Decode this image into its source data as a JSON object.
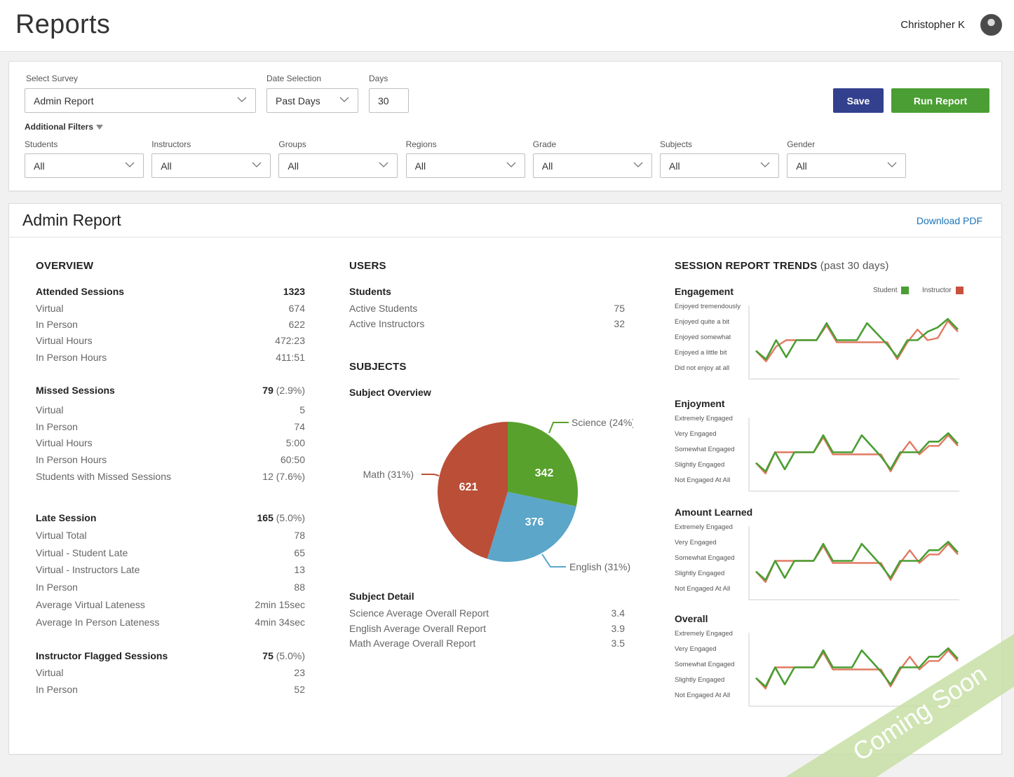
{
  "header": {
    "title": "Reports",
    "user_name": "Christopher K"
  },
  "filters": {
    "survey": {
      "label": "Select Survey",
      "value": "Admin Report"
    },
    "date_selection": {
      "label": "Date Selection",
      "value": "Past Days"
    },
    "days": {
      "label": "Days",
      "value": "30"
    },
    "save_label": "Save",
    "run_label": "Run Report",
    "additional_label": "Additional Filters",
    "dropdowns": [
      {
        "label": "Students",
        "value": "All"
      },
      {
        "label": "Instructors",
        "value": "All"
      },
      {
        "label": "Groups",
        "value": "All"
      },
      {
        "label": "Regions",
        "value": "All"
      },
      {
        "label": "Grade",
        "value": "All"
      },
      {
        "label": "Subjects",
        "value": "All"
      },
      {
        "label": "Gender",
        "value": "All"
      }
    ]
  },
  "report": {
    "title": "Admin Report",
    "download_label": "Download PDF",
    "overview": {
      "heading": "OVERVIEW",
      "attended": {
        "label": "Attended Sessions",
        "value": "1323"
      },
      "attended_rows": [
        {
          "k": "Virtual",
          "v": "674"
        },
        {
          "k": "In Person",
          "v": "622"
        },
        {
          "k": "Virtual Hours",
          "v": "472:23"
        },
        {
          "k": "In Person Hours",
          "v": "411:51"
        }
      ],
      "missed": {
        "label": "Missed Sessions",
        "value": "79",
        "pct": "(2.9%)"
      },
      "missed_rows": [
        {
          "k": "Virtual",
          "v": "5"
        },
        {
          "k": "In Person",
          "v": "74"
        },
        {
          "k": "Virtual Hours",
          "v": "5:00"
        },
        {
          "k": "In Person Hours",
          "v": "60:50"
        },
        {
          "k": "Students with Missed Sessions",
          "v": "12",
          "pct": "(7.6%)"
        }
      ],
      "late": {
        "label": "Late Session",
        "value": "165",
        "pct": "(5.0%)"
      },
      "late_rows": [
        {
          "k": "Virtual Total",
          "v": "78"
        },
        {
          "k": "Virtual - Student Late",
          "v": "65"
        },
        {
          "k": "Virtual - Instructors Late",
          "v": "13"
        },
        {
          "k": "In Person",
          "v": "88"
        },
        {
          "k": "Average Virtual Lateness",
          "v": "2min 15sec"
        },
        {
          "k": "Average In Person Lateness",
          "v": "4min 34sec"
        }
      ],
      "flagged": {
        "label": "Instructor Flagged Sessions",
        "value": "75",
        "pct": "(5.0%)"
      },
      "flagged_rows": [
        {
          "k": "Virtual",
          "v": "23"
        },
        {
          "k": "In Person",
          "v": "52"
        }
      ]
    },
    "users": {
      "heading": "USERS",
      "students_label": "Students",
      "rows": [
        {
          "k": "Active Students",
          "v": "75"
        },
        {
          "k": "Active Instructors",
          "v": "32"
        }
      ]
    },
    "subjects": {
      "heading": "SUBJECTS",
      "overview_label": "Subject Overview",
      "detail_label": "Subject Detail",
      "detail_rows": [
        {
          "k": "Science Average Overall Report",
          "v": "3.4"
        },
        {
          "k": "English Average Overall Report",
          "v": "3.9"
        },
        {
          "k": "Math Average Overall Report",
          "v": "3.5"
        }
      ]
    },
    "trends": {
      "heading": "SESSION REPORT TRENDS",
      "heading_suffix": "(past 30 days)",
      "legend_student": "Student",
      "legend_instructor": "Instructor",
      "colors": {
        "student": "#4a9e33",
        "instructor": "#e07a62"
      }
    }
  },
  "watermark": "Coming Soon",
  "chart_data": [
    {
      "type": "pie",
      "title": "Subject Overview",
      "slices": [
        {
          "label": "Science",
          "value": 342,
          "pct_label": "(24%)",
          "color": "#58a12c"
        },
        {
          "label": "English",
          "value": 376,
          "pct_label": "(31%)",
          "color": "#5ba6c9"
        },
        {
          "label": "Math",
          "value": 621,
          "pct_label": "(31%)",
          "color": "#bb4e37"
        }
      ]
    },
    {
      "type": "line",
      "title": "Engagement",
      "y_levels": [
        "Enjoyed tremendously",
        "Enjoyed quite a bit",
        "Enjoyed somewhat",
        "Enjoyed a little bit",
        "Did not enjoy at all"
      ],
      "series": [
        {
          "name": "Student",
          "values": [
            2.0,
            1.6,
            2.5,
            1.7,
            2.5,
            2.5,
            2.5,
            3.3,
            2.5,
            2.5,
            2.5,
            3.3,
            2.8,
            2.3,
            1.7,
            2.5,
            2.5,
            2.9,
            3.1,
            3.5,
            3.0
          ]
        },
        {
          "name": "Instructor",
          "values": [
            2.0,
            1.5,
            2.2,
            2.5,
            2.5,
            2.5,
            2.5,
            3.2,
            2.4,
            2.4,
            2.4,
            2.4,
            2.4,
            2.4,
            1.6,
            2.4,
            3.0,
            2.5,
            2.6,
            3.4,
            2.9
          ]
        }
      ]
    },
    {
      "type": "line",
      "title": "Enjoyment",
      "y_levels": [
        "Extremely Engaged",
        "Very Engaged",
        "Somewhat Engaged",
        "Slightly Engaged",
        "Not Engaged At All"
      ],
      "series": [
        {
          "name": "Student",
          "values": [
            2.0,
            1.6,
            2.5,
            1.7,
            2.5,
            2.5,
            2.5,
            3.3,
            2.5,
            2.5,
            2.5,
            3.3,
            2.8,
            2.3,
            1.7,
            2.5,
            2.5,
            2.5,
            3.0,
            3.0,
            3.4,
            2.9
          ]
        },
        {
          "name": "Instructor",
          "values": [
            2.0,
            1.5,
            2.5,
            2.5,
            2.5,
            2.5,
            2.5,
            3.2,
            2.4,
            2.4,
            2.4,
            2.4,
            2.4,
            2.4,
            1.6,
            2.4,
            3.0,
            2.4,
            2.8,
            2.8,
            3.3,
            2.8
          ]
        }
      ]
    },
    {
      "type": "line",
      "title": "Amount Learned",
      "y_levels": [
        "Extremely Engaged",
        "Very Engaged",
        "Somewhat Engaged",
        "Slightly Engaged",
        "Not Engaged At All"
      ],
      "series": [
        {
          "name": "Student",
          "values": [
            2.0,
            1.6,
            2.5,
            1.7,
            2.5,
            2.5,
            2.5,
            3.3,
            2.5,
            2.5,
            2.5,
            3.3,
            2.8,
            2.3,
            1.7,
            2.5,
            2.5,
            2.5,
            3.0,
            3.0,
            3.4,
            2.9
          ]
        },
        {
          "name": "Instructor",
          "values": [
            2.0,
            1.5,
            2.5,
            2.5,
            2.5,
            2.5,
            2.5,
            3.2,
            2.4,
            2.4,
            2.4,
            2.4,
            2.4,
            2.4,
            1.6,
            2.4,
            3.0,
            2.4,
            2.8,
            2.8,
            3.3,
            2.8
          ]
        }
      ]
    },
    {
      "type": "line",
      "title": "Overall",
      "y_levels": [
        "Extremely Engaged",
        "Very Engaged",
        "Somewhat Engaged",
        "Slightly Engaged",
        "Not Engaged At All"
      ],
      "series": [
        {
          "name": "Student",
          "values": [
            2.0,
            1.6,
            2.5,
            1.7,
            2.5,
            2.5,
            2.5,
            3.3,
            2.5,
            2.5,
            2.5,
            3.3,
            2.8,
            2.3,
            1.7,
            2.5,
            2.5,
            2.5,
            3.0,
            3.0,
            3.4,
            2.9
          ]
        },
        {
          "name": "Instructor",
          "values": [
            2.0,
            1.5,
            2.5,
            2.5,
            2.5,
            2.5,
            2.5,
            3.2,
            2.4,
            2.4,
            2.4,
            2.4,
            2.4,
            2.4,
            1.6,
            2.4,
            3.0,
            2.4,
            2.8,
            2.8,
            3.3,
            2.8
          ]
        }
      ]
    }
  ]
}
